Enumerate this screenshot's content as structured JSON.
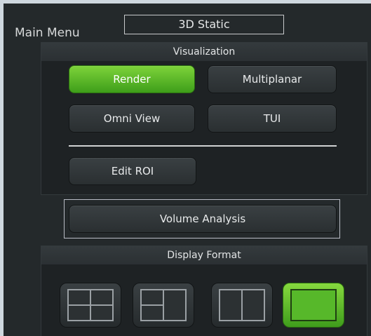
{
  "main_menu": {
    "label": "Main Menu"
  },
  "mode": {
    "label": "3D Static"
  },
  "visualization": {
    "title": "Visualization",
    "buttons": [
      "Render",
      "Multiplanar",
      "Omni View",
      "TUI",
      "Edit ROI"
    ],
    "active": "Render"
  },
  "volume_analysis": {
    "label": "Volume Analysis"
  },
  "display_format": {
    "title": "Display Format",
    "layouts": [
      "quad-layout-icon",
      "triple-layout-icon",
      "dual-layout-icon",
      "single-layout-icon"
    ],
    "active": "single-layout-icon"
  },
  "colors": {
    "accent": "#4caf26",
    "background": "#24292b",
    "text": "#e8eaeb"
  }
}
